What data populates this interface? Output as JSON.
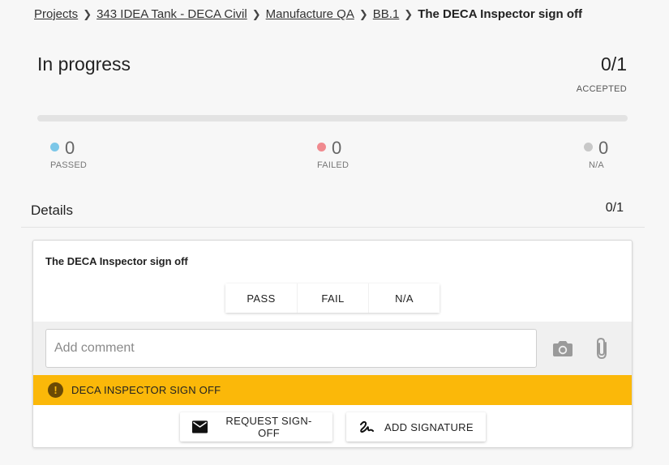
{
  "breadcrumb": {
    "items": [
      "Projects",
      "343 IDEA Tank - DECA Civil",
      "Manufacture QA",
      "BB.1"
    ],
    "current": "The DECA Inspector sign off"
  },
  "summary": {
    "status": "In progress",
    "accepted_count": "0/1",
    "accepted_label": "ACCEPTED",
    "progress_fraction": 0
  },
  "stats": {
    "passed": {
      "value": "0",
      "label": "PASSED",
      "color": "#7cc7e8"
    },
    "failed": {
      "value": "0",
      "label": "FAILED",
      "color": "#f08a8f"
    },
    "na": {
      "value": "0",
      "label": "N/A",
      "color": "#c8c8c8"
    }
  },
  "details": {
    "title": "Details",
    "count": "0/1"
  },
  "item": {
    "title": "The DECA Inspector sign off",
    "choices": [
      "PASS",
      "FAIL",
      "N/A"
    ],
    "comment_placeholder": "Add comment",
    "comment_value": "",
    "warning": "DECA INSPECTOR SIGN OFF",
    "warning_color": "#fbb809",
    "request_label": "REQUEST SIGN-OFF",
    "signature_label": "ADD SIGNATURE"
  },
  "icons": {
    "camera": "camera-icon",
    "attach": "paperclip-icon",
    "warning": "warning-icon",
    "mail": "mail-icon",
    "signature": "signature-icon"
  }
}
